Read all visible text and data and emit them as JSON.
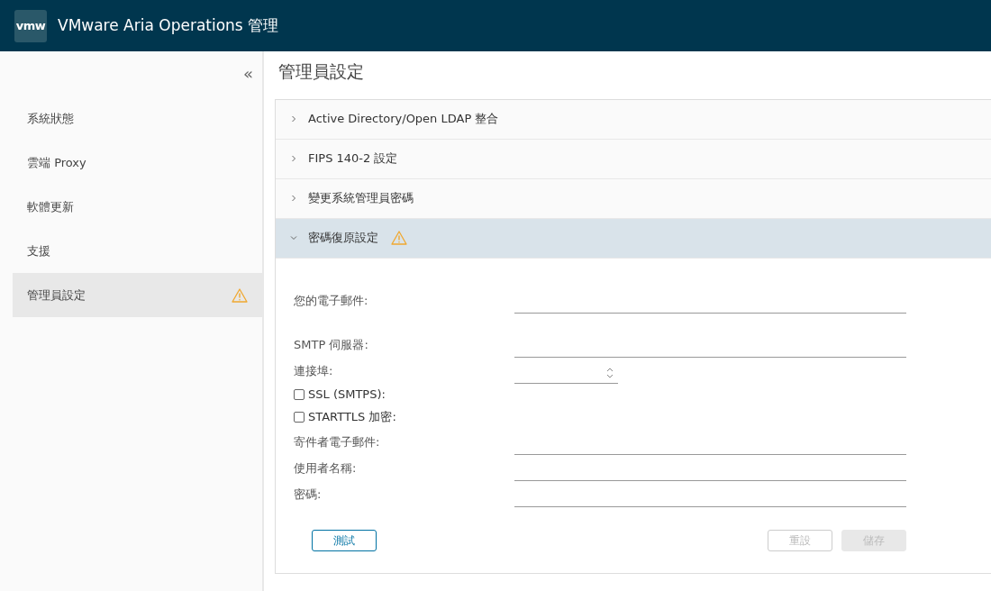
{
  "header": {
    "logo": "vmw",
    "title": "VMware Aria Operations 管理"
  },
  "sidebar": {
    "collapse_glyph": "«",
    "items": [
      {
        "label": "系統狀態",
        "selected": false,
        "warning": false
      },
      {
        "label": "雲端 Proxy",
        "selected": false,
        "warning": false
      },
      {
        "label": "軟體更新",
        "selected": false,
        "warning": false
      },
      {
        "label": "支援",
        "selected": false,
        "warning": false
      },
      {
        "label": "管理員設定",
        "selected": true,
        "warning": true
      }
    ]
  },
  "page_title": "管理員設定",
  "sections": [
    {
      "title": "Active Directory/Open LDAP 整合",
      "expanded": false,
      "warning": false
    },
    {
      "title": "FIPS 140-2 設定",
      "expanded": false,
      "warning": false
    },
    {
      "title": "變更系統管理員密碼",
      "expanded": false,
      "warning": false
    },
    {
      "title": "密碼復原設定",
      "expanded": true,
      "warning": true
    }
  ],
  "form": {
    "fields": [
      {
        "kind": "text",
        "label": "您的電子郵件:"
      },
      {
        "kind": "text",
        "label": "SMTP 伺服器:"
      },
      {
        "kind": "number",
        "label": "連接埠:"
      },
      {
        "kind": "checkbox",
        "label": "SSL (SMTPS):",
        "checked": false
      },
      {
        "kind": "checkbox",
        "label": "STARTTLS 加密:",
        "checked": false
      },
      {
        "kind": "text",
        "label": "寄件者電子郵件:"
      },
      {
        "kind": "text",
        "label": "使用者名稱:"
      },
      {
        "kind": "password",
        "label": "密碼:"
      }
    ],
    "buttons": [
      {
        "label": "測試",
        "kind": "outline",
        "disabled": false
      },
      {
        "label": "重設",
        "kind": "outline",
        "disabled": true
      },
      {
        "label": "儲存",
        "kind": "solid",
        "disabled": true
      }
    ]
  }
}
